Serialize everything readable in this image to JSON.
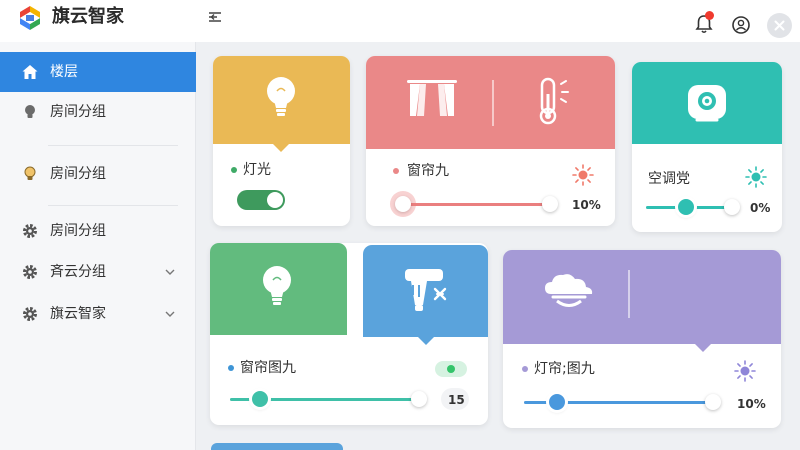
{
  "app": {
    "title": "旗云智家"
  },
  "sidebar": {
    "items": [
      {
        "label": "楼层"
      },
      {
        "label": "房间分组"
      },
      {
        "label": "房间分组"
      },
      {
        "label": "房间分组"
      },
      {
        "label": "斉云分组"
      },
      {
        "label": "旗云智家"
      }
    ]
  },
  "cards": {
    "light1": {
      "title": "灯光",
      "on": true
    },
    "curtain1": {
      "title": "窗帘九",
      "value": "10%",
      "level": 0.0
    },
    "ac": {
      "title": "空调党",
      "value": "0%",
      "level": 0.0
    },
    "light2": {
      "title": "窗帘图九",
      "value": "15%",
      "level": 0.0
    },
    "curtain2": {
      "title": "灯帘;图九",
      "value": "10%",
      "level": 0.0
    }
  },
  "colors": {
    "accent": "#2f86e0",
    "yellow": "#eab955",
    "salmon": "#ea8888",
    "teal": "#2fbfb2",
    "green": "#62bb7e",
    "blue": "#5aa3dc",
    "purple": "#a59ad6"
  }
}
